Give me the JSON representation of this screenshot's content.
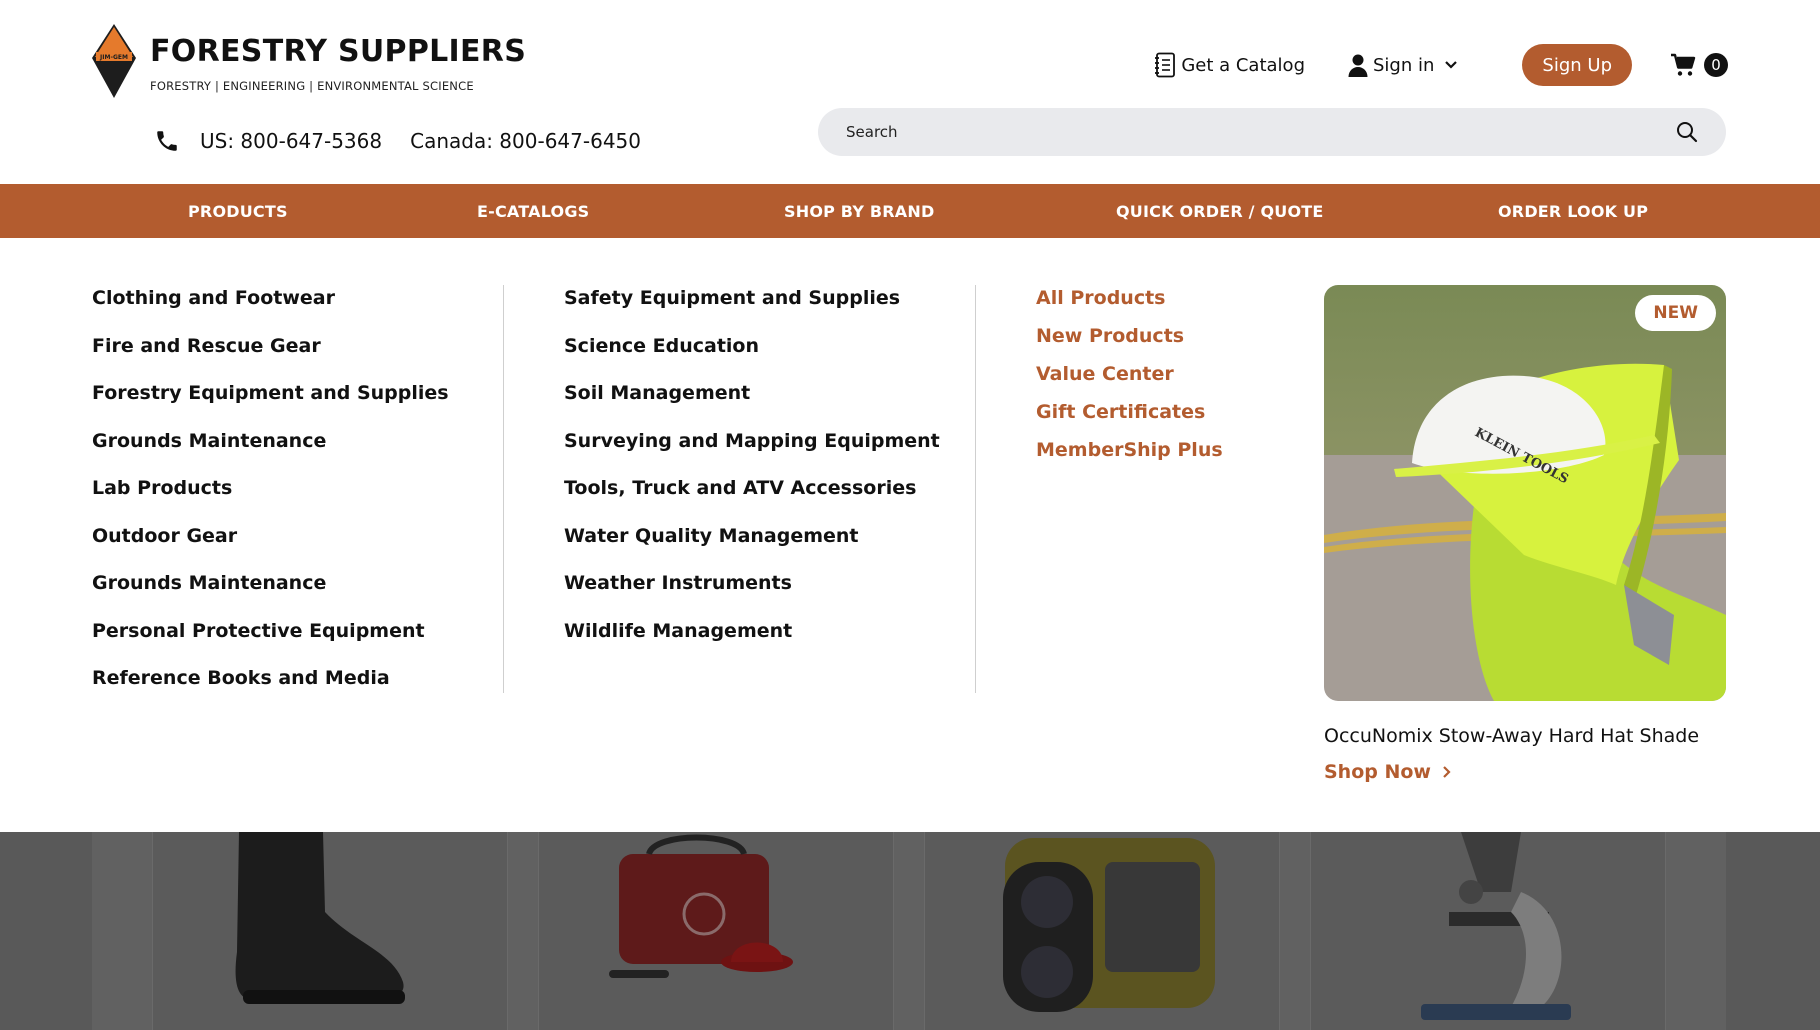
{
  "brand": {
    "name": "FORESTRY SUPPLIERS",
    "tagline": "FORESTRY | ENGINEERING | ENVIRONMENTAL SCIENCE",
    "logo_text": "JIM-GEM"
  },
  "contact": {
    "us": "US: 800-647-5368",
    "canada": "Canada: 800-647-6450"
  },
  "top_links": {
    "catalog": "Get a Catalog",
    "signin": "Sign in",
    "signup": "Sign Up",
    "cart_count": "0"
  },
  "search": {
    "placeholder": "Search"
  },
  "nav": {
    "items": [
      "PRODUCTS",
      "E-CATALOGS",
      "SHOP BY BRAND",
      "QUICK ORDER / QUOTE",
      "ORDER LOOK UP"
    ]
  },
  "menu": {
    "col1": [
      "Clothing and Footwear",
      "Fire and Rescue Gear",
      "Forestry Equipment and Supplies",
      "Grounds Maintenance",
      "Lab Products",
      "Outdoor Gear",
      "Grounds Maintenance",
      "Personal Protective Equipment",
      "Reference Books and Media"
    ],
    "col2": [
      "Safety Equipment and Supplies",
      "Science Education",
      "Soil Management",
      "Surveying and Mapping Equipment",
      "Tools, Truck and ATV Accessories",
      "Water Quality Management",
      "Weather Instruments",
      "Wildlife Management"
    ],
    "col3": [
      "All Products",
      "New Products",
      "Value Center",
      "Gift Certificates",
      "MemberShip Plus"
    ]
  },
  "promo": {
    "badge": "NEW",
    "title": "OccuNomix Stow-Away Hard Hat Shade",
    "cta": "Shop Now",
    "hat_text": "KLEIN TOOLS"
  },
  "colors": {
    "accent": "#b35c2f",
    "search_bg": "#e9eaed",
    "backdrop": "#595959"
  },
  "icons": {
    "catalog": "catalog-icon",
    "user": "user-icon",
    "chevron": "chevron-down-icon",
    "cart": "cart-icon",
    "phone": "phone-icon",
    "search": "search-icon"
  }
}
